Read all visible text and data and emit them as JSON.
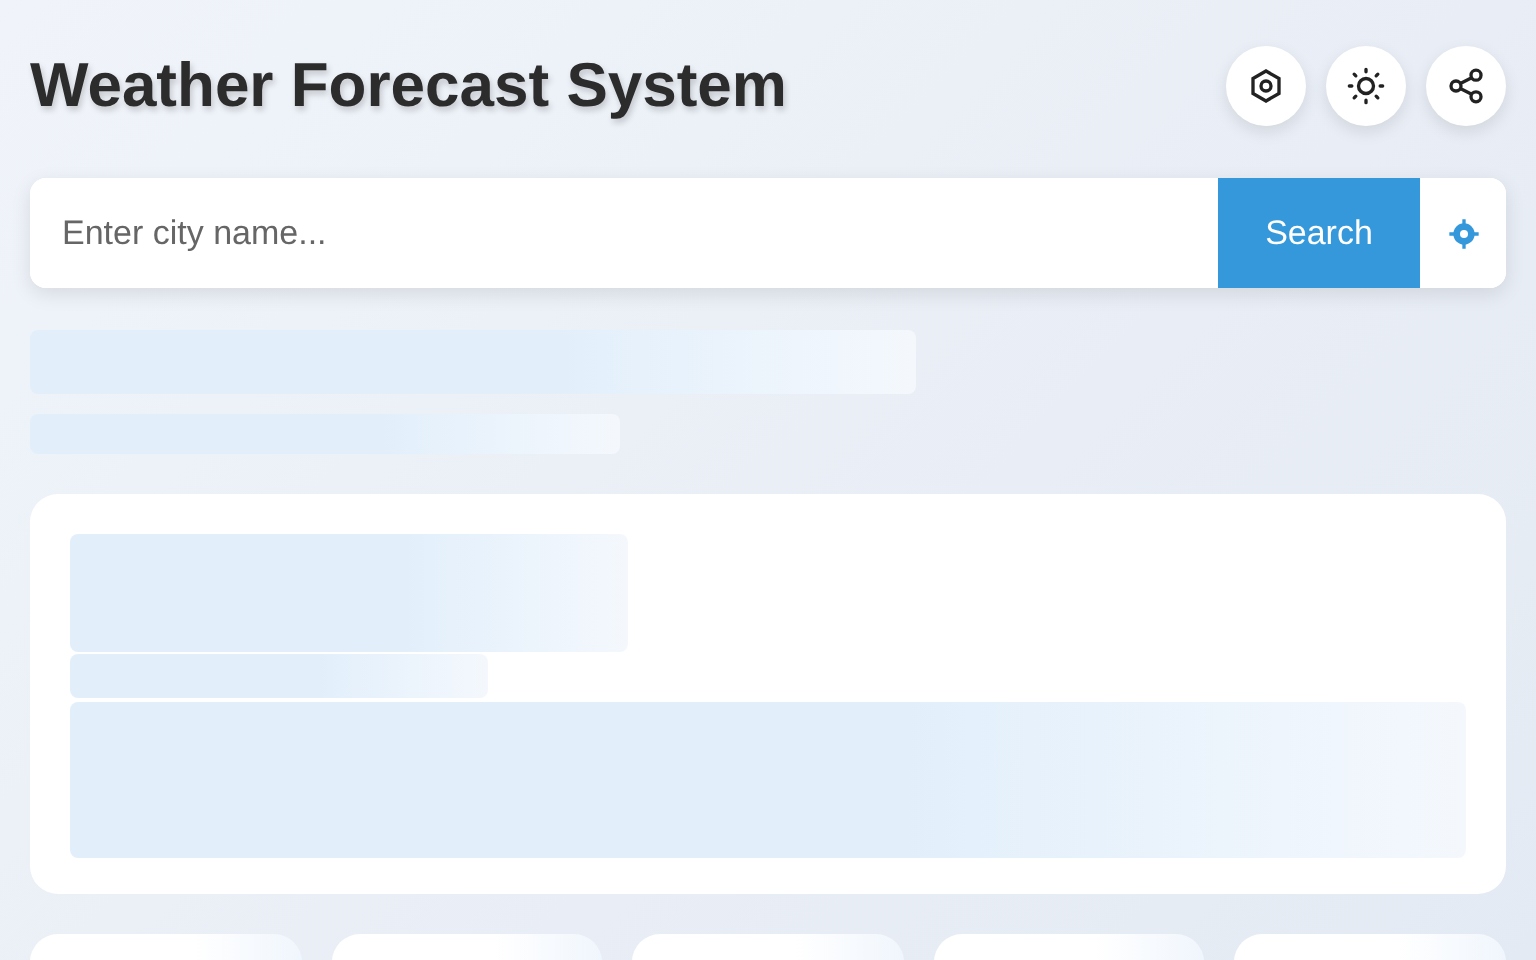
{
  "header": {
    "title": "Weather Forecast System"
  },
  "search": {
    "placeholder": "Enter city name...",
    "button": "Search"
  }
}
